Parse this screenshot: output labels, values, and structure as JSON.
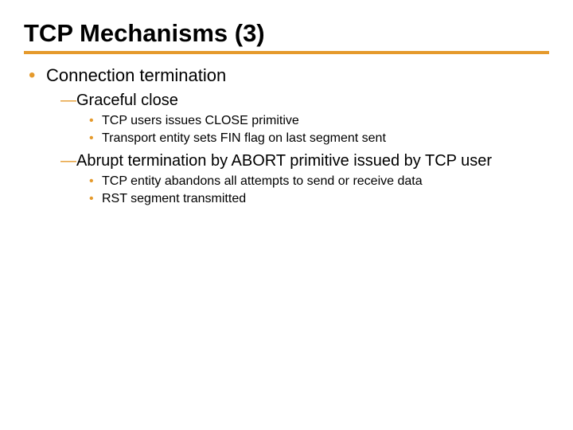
{
  "title": "TCP Mechanisms (3)",
  "lvl1": {
    "item0": {
      "text": "Connection termination",
      "sub": {
        "item0": {
          "text": "Graceful close",
          "sub": {
            "item0": "TCP users issues CLOSE primitive",
            "item1": "Transport entity sets FIN flag on last segment sent"
          }
        },
        "item1": {
          "text": "Abrupt termination by ABORT primitive issued by TCP user",
          "sub": {
            "item0": "TCP entity abandons all attempts to send or receive data",
            "item1": "RST segment transmitted"
          }
        }
      }
    }
  }
}
